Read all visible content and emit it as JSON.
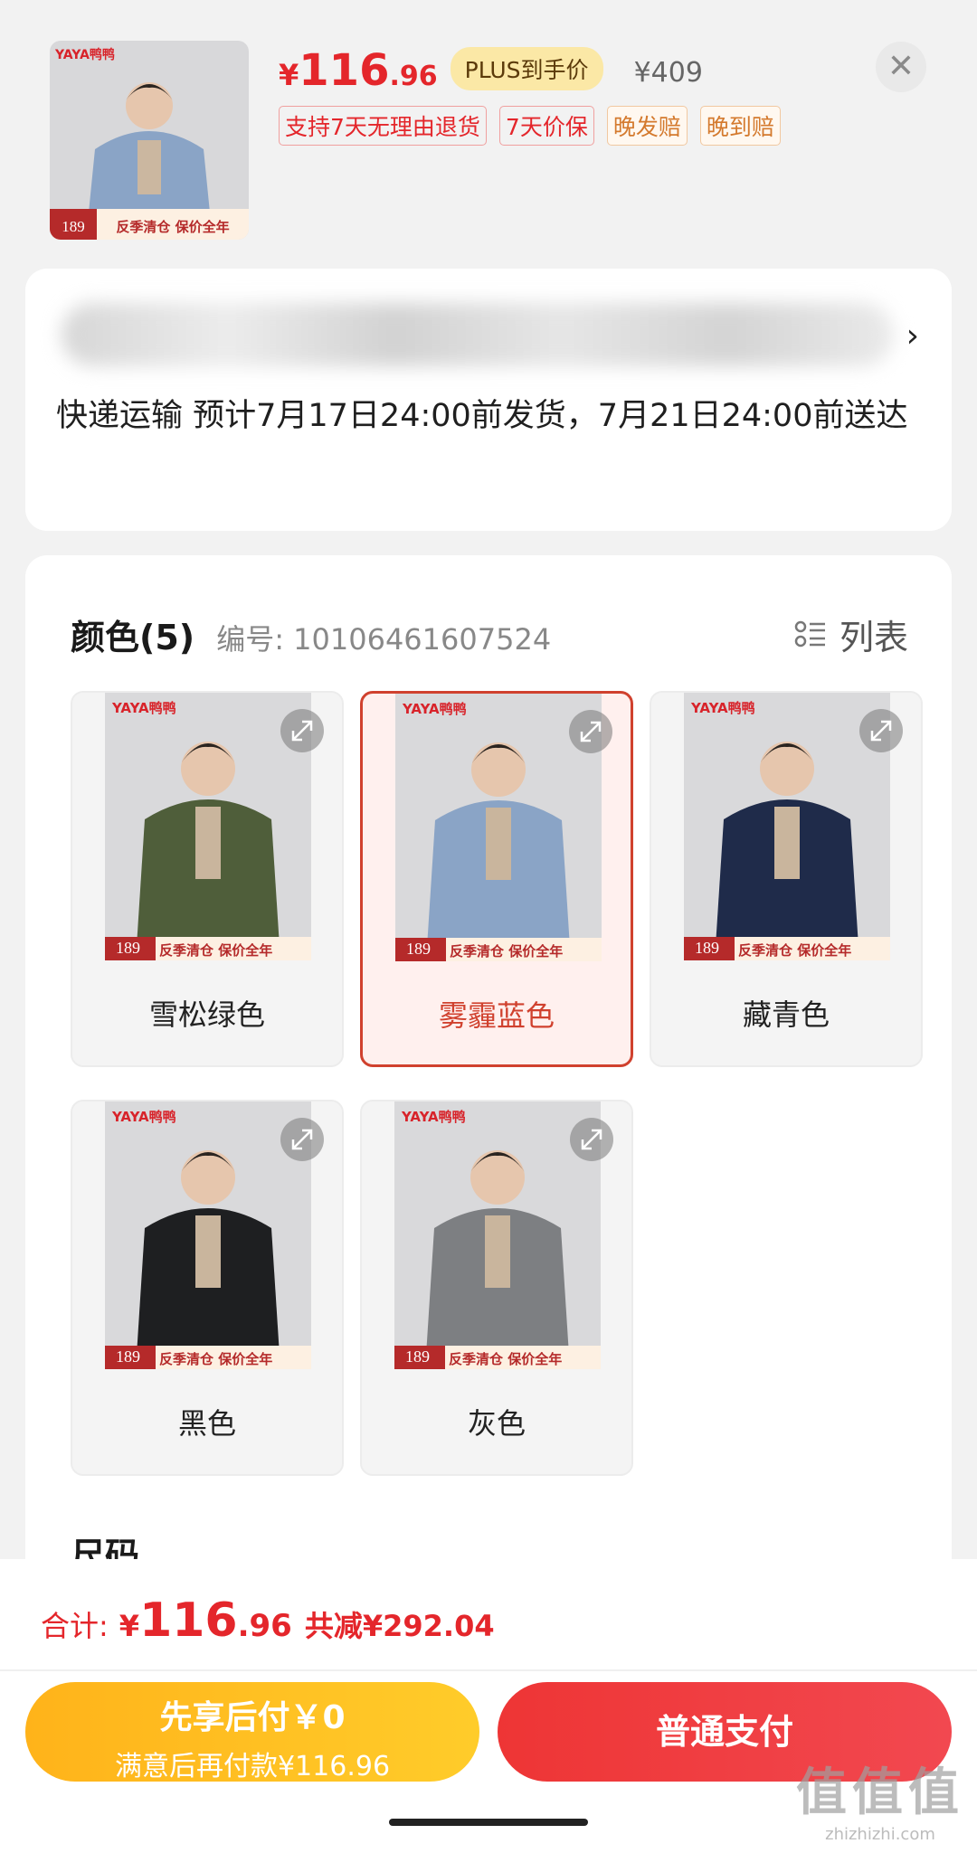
{
  "header": {
    "brand": "YAYA鸭鸭",
    "price_yen": "¥",
    "price_int": "116",
    "price_dec": ".96",
    "plus_label": "PLUS到手价",
    "original_price": "¥409",
    "close_icon": "close-icon",
    "tags": [
      "支持7天无理由退货",
      "7天价保",
      "晚发赔",
      "晚到赔"
    ],
    "banner_price": "189",
    "banner_text": "反季清仓 保价全年"
  },
  "address": {
    "delivery_text": "快递运输 预计7月17日24:00前发货，7月21日24:00前送达"
  },
  "spec": {
    "color_title": "颜色(5)",
    "code_label": "编号: 10106461607524",
    "list_label": "列表",
    "colors": [
      {
        "label": "雪松绿色",
        "color": "#4f5e3a",
        "selected": false
      },
      {
        "label": "雾霾蓝色",
        "color": "#8aa4c6",
        "selected": true
      },
      {
        "label": "藏青色",
        "color": "#1f2b4a",
        "selected": false
      },
      {
        "label": "黑色",
        "color": "#1e1f21",
        "selected": false
      },
      {
        "label": "灰色",
        "color": "#7d7f82",
        "selected": false
      }
    ],
    "size_title": "尺码"
  },
  "footer": {
    "total_label": "合计:",
    "total_yen": "¥",
    "total_int": "116",
    "total_dec": ".96",
    "save_text": "共减¥292.04",
    "later_line1": "先享后付￥0",
    "later_line2": "满意后再付款¥116.96",
    "pay_label": "普通支付"
  },
  "watermark": {
    "line1": "值值值",
    "line2": "zhizhizhi.com"
  },
  "colors": {
    "accent_red": "#e4262b",
    "selected_border": "#d0412e",
    "yellow_btn": "#ffbf20"
  }
}
